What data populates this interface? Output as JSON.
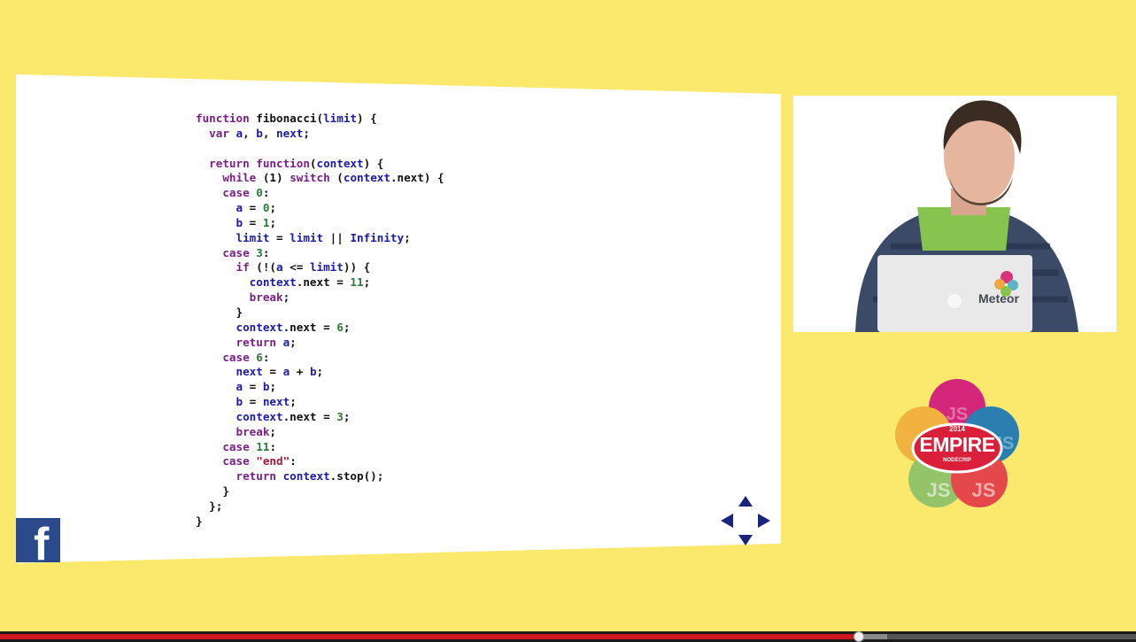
{
  "slide": {
    "code_lines": [
      [
        {
          "t": "function ",
          "c": "kw"
        },
        {
          "t": "fibonacci(",
          "c": "pl"
        },
        {
          "t": "limit",
          "c": "id"
        },
        {
          "t": ") {",
          "c": "pl"
        }
      ],
      [
        {
          "t": "  ",
          "c": "pl"
        },
        {
          "t": "var ",
          "c": "kw"
        },
        {
          "t": "a",
          "c": "id"
        },
        {
          "t": ", ",
          "c": "pl"
        },
        {
          "t": "b",
          "c": "id"
        },
        {
          "t": ", ",
          "c": "pl"
        },
        {
          "t": "next",
          "c": "id"
        },
        {
          "t": ";",
          "c": "pl"
        }
      ],
      [
        {
          "t": "",
          "c": "pl"
        }
      ],
      [
        {
          "t": "  ",
          "c": "pl"
        },
        {
          "t": "return function",
          "c": "kw"
        },
        {
          "t": "(",
          "c": "pl"
        },
        {
          "t": "context",
          "c": "id"
        },
        {
          "t": ") {",
          "c": "pl"
        }
      ],
      [
        {
          "t": "    ",
          "c": "pl"
        },
        {
          "t": "while ",
          "c": "kw"
        },
        {
          "t": "(1) ",
          "c": "pl"
        },
        {
          "t": "switch ",
          "c": "kw"
        },
        {
          "t": "(",
          "c": "pl"
        },
        {
          "t": "context",
          "c": "id"
        },
        {
          "t": ".next) {",
          "c": "pl"
        }
      ],
      [
        {
          "t": "    ",
          "c": "pl"
        },
        {
          "t": "case ",
          "c": "kw"
        },
        {
          "t": "0",
          "c": "num"
        },
        {
          "t": ":",
          "c": "pl"
        }
      ],
      [
        {
          "t": "      ",
          "c": "pl"
        },
        {
          "t": "a",
          "c": "id"
        },
        {
          "t": " = ",
          "c": "pl"
        },
        {
          "t": "0",
          "c": "num"
        },
        {
          "t": ";",
          "c": "pl"
        }
      ],
      [
        {
          "t": "      ",
          "c": "pl"
        },
        {
          "t": "b",
          "c": "id"
        },
        {
          "t": " = ",
          "c": "pl"
        },
        {
          "t": "1",
          "c": "num"
        },
        {
          "t": ";",
          "c": "pl"
        }
      ],
      [
        {
          "t": "      ",
          "c": "pl"
        },
        {
          "t": "limit",
          "c": "id"
        },
        {
          "t": " = ",
          "c": "pl"
        },
        {
          "t": "limit",
          "c": "id"
        },
        {
          "t": " || ",
          "c": "pl"
        },
        {
          "t": "Infinity",
          "c": "id"
        },
        {
          "t": ";",
          "c": "pl"
        }
      ],
      [
        {
          "t": "    ",
          "c": "pl"
        },
        {
          "t": "case ",
          "c": "kw"
        },
        {
          "t": "3",
          "c": "num"
        },
        {
          "t": ":",
          "c": "pl"
        }
      ],
      [
        {
          "t": "      ",
          "c": "pl"
        },
        {
          "t": "if ",
          "c": "kw"
        },
        {
          "t": "(!(",
          "c": "pl"
        },
        {
          "t": "a",
          "c": "id"
        },
        {
          "t": " <= ",
          "c": "pl"
        },
        {
          "t": "limit",
          "c": "id"
        },
        {
          "t": ")) {",
          "c": "pl"
        }
      ],
      [
        {
          "t": "        ",
          "c": "pl"
        },
        {
          "t": "context",
          "c": "id"
        },
        {
          "t": ".next = ",
          "c": "pl"
        },
        {
          "t": "11",
          "c": "num"
        },
        {
          "t": ";",
          "c": "pl"
        }
      ],
      [
        {
          "t": "        ",
          "c": "pl"
        },
        {
          "t": "break",
          "c": "kw"
        },
        {
          "t": ";",
          "c": "pl"
        }
      ],
      [
        {
          "t": "      }",
          "c": "pl"
        }
      ],
      [
        {
          "t": "      ",
          "c": "pl"
        },
        {
          "t": "context",
          "c": "id"
        },
        {
          "t": ".next = ",
          "c": "pl"
        },
        {
          "t": "6",
          "c": "num"
        },
        {
          "t": ";",
          "c": "pl"
        }
      ],
      [
        {
          "t": "      ",
          "c": "pl"
        },
        {
          "t": "return ",
          "c": "kw"
        },
        {
          "t": "a",
          "c": "id"
        },
        {
          "t": ";",
          "c": "pl"
        }
      ],
      [
        {
          "t": "    ",
          "c": "pl"
        },
        {
          "t": "case ",
          "c": "kw"
        },
        {
          "t": "6",
          "c": "num"
        },
        {
          "t": ":",
          "c": "pl"
        }
      ],
      [
        {
          "t": "      ",
          "c": "pl"
        },
        {
          "t": "next",
          "c": "id"
        },
        {
          "t": " = ",
          "c": "pl"
        },
        {
          "t": "a",
          "c": "id"
        },
        {
          "t": " + ",
          "c": "pl"
        },
        {
          "t": "b",
          "c": "id"
        },
        {
          "t": ";",
          "c": "pl"
        }
      ],
      [
        {
          "t": "      ",
          "c": "pl"
        },
        {
          "t": "a",
          "c": "id"
        },
        {
          "t": " = ",
          "c": "pl"
        },
        {
          "t": "b",
          "c": "id"
        },
        {
          "t": ";",
          "c": "pl"
        }
      ],
      [
        {
          "t": "      ",
          "c": "pl"
        },
        {
          "t": "b",
          "c": "id"
        },
        {
          "t": " = ",
          "c": "pl"
        },
        {
          "t": "next",
          "c": "id"
        },
        {
          "t": ";",
          "c": "pl"
        }
      ],
      [
        {
          "t": "      ",
          "c": "pl"
        },
        {
          "t": "context",
          "c": "id"
        },
        {
          "t": ".next = ",
          "c": "pl"
        },
        {
          "t": "3",
          "c": "num"
        },
        {
          "t": ";",
          "c": "pl"
        }
      ],
      [
        {
          "t": "      ",
          "c": "pl"
        },
        {
          "t": "break",
          "c": "kw"
        },
        {
          "t": ";",
          "c": "pl"
        }
      ],
      [
        {
          "t": "    ",
          "c": "pl"
        },
        {
          "t": "case ",
          "c": "kw"
        },
        {
          "t": "11",
          "c": "num"
        },
        {
          "t": ":",
          "c": "pl"
        }
      ],
      [
        {
          "t": "    ",
          "c": "pl"
        },
        {
          "t": "case ",
          "c": "kw"
        },
        {
          "t": "\"end\"",
          "c": "str"
        },
        {
          "t": ":",
          "c": "pl"
        }
      ],
      [
        {
          "t": "      ",
          "c": "pl"
        },
        {
          "t": "return ",
          "c": "kw"
        },
        {
          "t": "context",
          "c": "id"
        },
        {
          "t": ".stop();",
          "c": "pl"
        }
      ],
      [
        {
          "t": "    }",
          "c": "pl"
        }
      ],
      [
        {
          "t": "  };",
          "c": "pl"
        }
      ],
      [
        {
          "t": "}",
          "c": "pl"
        }
      ]
    ]
  },
  "presenter": {
    "laptop_brand": "Meteor"
  },
  "conference_logo": {
    "year": "2014",
    "name": "EMPIRE",
    "subtitle": "NODECRIP",
    "js_marks": [
      "JS",
      "JS",
      "JS",
      "JS"
    ]
  },
  "badge": {
    "glyph": "f",
    "icon": "facebook-icon"
  },
  "player": {
    "progress_fraction": 0.756,
    "buffered_fraction": 0.781
  },
  "colors": {
    "background": "#fbe96e",
    "keyword": "#7a1f86",
    "identifier": "#1a1aa6",
    "number": "#2a7a3a",
    "string": "#a8173a",
    "progress": "#cc181e",
    "facebook": "#2b4a8c"
  }
}
